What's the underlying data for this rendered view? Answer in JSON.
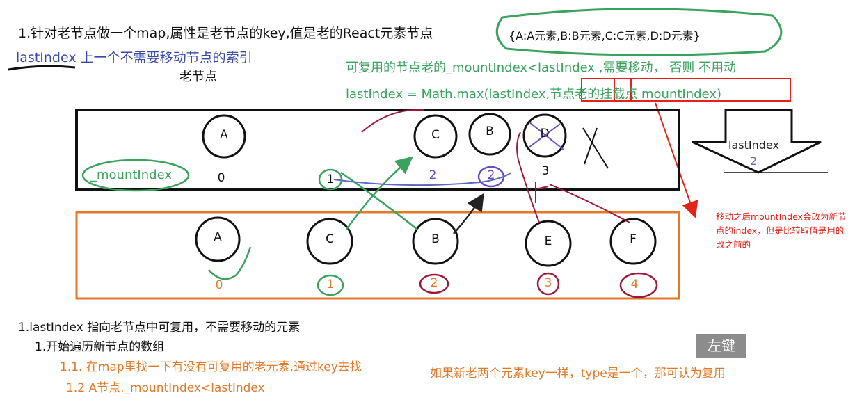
{
  "title": "1.针对老节点做一个map,属性是老节点的key,值是老的React元素节点",
  "map_literal": "{A:A元素,B:B元素,C:C元素,D:D元素}",
  "lastindex_definition": "lastIndex  上一个不需要移动节点的索引",
  "old_label": "老节点",
  "reuse_rule": "可复用的节点老的_mountIndex<lastIndex ,需要移动， 否则 不用动",
  "formula": "lastIndex = Math.max(lastIndex,节点老的挂载点 mountIndex)",
  "red_note": "移动之后mountIndex会改为新节点的index，但是比较取值是用的改之前的",
  "lastindex_arrow": {
    "label": "lastIndex",
    "value": "2"
  },
  "mountindex_tag": "_mountIndex",
  "old_nodes": [
    {
      "label": "A",
      "index": "0"
    },
    {
      "label": "C",
      "index": "2"
    },
    {
      "label": "B",
      "index": "2"
    },
    {
      "label": "D",
      "index": "3"
    }
  ],
  "old_extra_index": "1",
  "new_nodes": [
    {
      "label": "A",
      "index": "0"
    },
    {
      "label": "C",
      "index": "1"
    },
    {
      "label": "B",
      "index": "2"
    },
    {
      "label": "E",
      "index": "3"
    },
    {
      "label": "F",
      "index": "4"
    }
  ],
  "steps": {
    "s1": "1.lastIndex 指向老节点中可复用，不需要移动的元素",
    "s1_1": "1.开始遍历新节点的数组",
    "s1_1_1": "1.1. 在map里找一下有没有可复用的老元素,通过key去找",
    "s1_1_note": "如果新老两个元素key一样，type是一个，那可认为复用",
    "s1_2": "1.2 A节点._mountIndex<lastIndex"
  },
  "left_key_label": "左键",
  "colors": {
    "green": "#3ba25e",
    "orange": "#e07a2a",
    "red": "#e2231a",
    "maroon": "#9b1a3a",
    "blue": "#3a4aa8",
    "purple": "#6a4bc0"
  }
}
